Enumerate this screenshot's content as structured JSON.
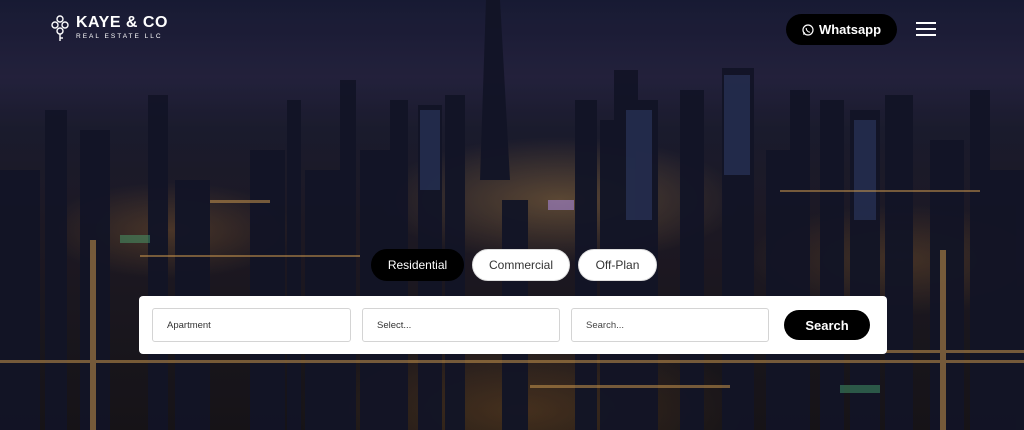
{
  "brand": {
    "name": "KAYE & CO",
    "tagline": "REAL ESTATE LLC"
  },
  "header": {
    "whatsapp_label": "Whatsapp",
    "menu_icon": "hamburger-menu-icon"
  },
  "tabs": [
    {
      "label": "Residential",
      "active": true
    },
    {
      "label": "Commercial",
      "active": false
    },
    {
      "label": "Off-Plan",
      "active": false
    }
  ],
  "search": {
    "property_type_value": "Apartment",
    "select_placeholder": "Select...",
    "search_placeholder": "Search...",
    "button_label": "Search"
  },
  "colors": {
    "button_bg": "#000000",
    "button_text": "#ffffff",
    "panel_bg": "#ffffff"
  }
}
